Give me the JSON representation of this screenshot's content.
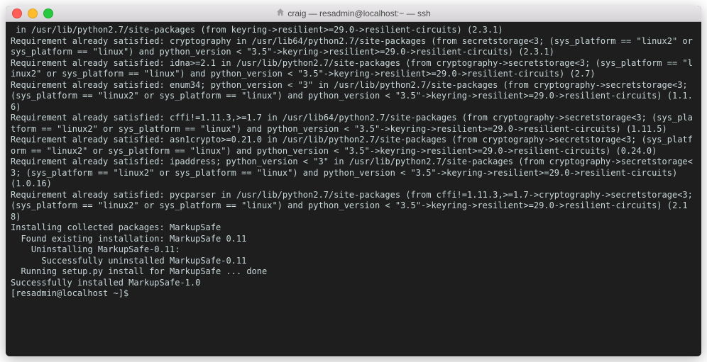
{
  "window": {
    "title": "craig — resadmin@localhost:~ — ssh"
  },
  "terminal": {
    "lines": [
      " in /usr/lib/python2.7/site-packages (from keyring->resilient>=29.0->resilient-circuits) (2.3.1)",
      "Requirement already satisfied: cryptography in /usr/lib64/python2.7/site-packages (from secretstorage<3; (sys_platform == \"linux2\" or sys_platform == \"linux\") and python_version < \"3.5\"->keyring->resilient>=29.0->resilient-circuits) (2.3.1)",
      "Requirement already satisfied: idna>=2.1 in /usr/lib/python2.7/site-packages (from cryptography->secretstorage<3; (sys_platform == \"linux2\" or sys_platform == \"linux\") and python_version < \"3.5\"->keyring->resilient>=29.0->resilient-circuits) (2.7)",
      "Requirement already satisfied: enum34; python_version < \"3\" in /usr/lib/python2.7/site-packages (from cryptography->secretstorage<3; (sys_platform == \"linux2\" or sys_platform == \"linux\") and python_version < \"3.5\"->keyring->resilient>=29.0->resilient-circuits) (1.1.6)",
      "Requirement already satisfied: cffi!=1.11.3,>=1.7 in /usr/lib64/python2.7/site-packages (from cryptography->secretstorage<3; (sys_platform == \"linux2\" or sys_platform == \"linux\") and python_version < \"3.5\"->keyring->resilient>=29.0->resilient-circuits) (1.11.5)",
      "Requirement already satisfied: asn1crypto>=0.21.0 in /usr/lib/python2.7/site-packages (from cryptography->secretstorage<3; (sys_platform == \"linux2\" or sys_platform == \"linux\") and python_version < \"3.5\"->keyring->resilient>=29.0->resilient-circuits) (0.24.0)",
      "Requirement already satisfied: ipaddress; python_version < \"3\" in /usr/lib/python2.7/site-packages (from cryptography->secretstorage<3; (sys_platform == \"linux2\" or sys_platform == \"linux\") and python_version < \"3.5\"->keyring->resilient>=29.0->resilient-circuits) (1.0.16)",
      "Requirement already satisfied: pycparser in /usr/lib/python2.7/site-packages (from cffi!=1.11.3,>=1.7->cryptography->secretstorage<3; (sys_platform == \"linux2\" or sys_platform == \"linux\") and python_version < \"3.5\"->keyring->resilient>=29.0->resilient-circuits) (2.18)",
      "Installing collected packages: MarkupSafe",
      "  Found existing installation: MarkupSafe 0.11",
      "    Uninstalling MarkupSafe-0.11:",
      "      Successfully uninstalled MarkupSafe-0.11",
      "  Running setup.py install for MarkupSafe ... done",
      "Successfully installed MarkupSafe-1.0"
    ],
    "prompt": "[resadmin@localhost ~]$"
  }
}
